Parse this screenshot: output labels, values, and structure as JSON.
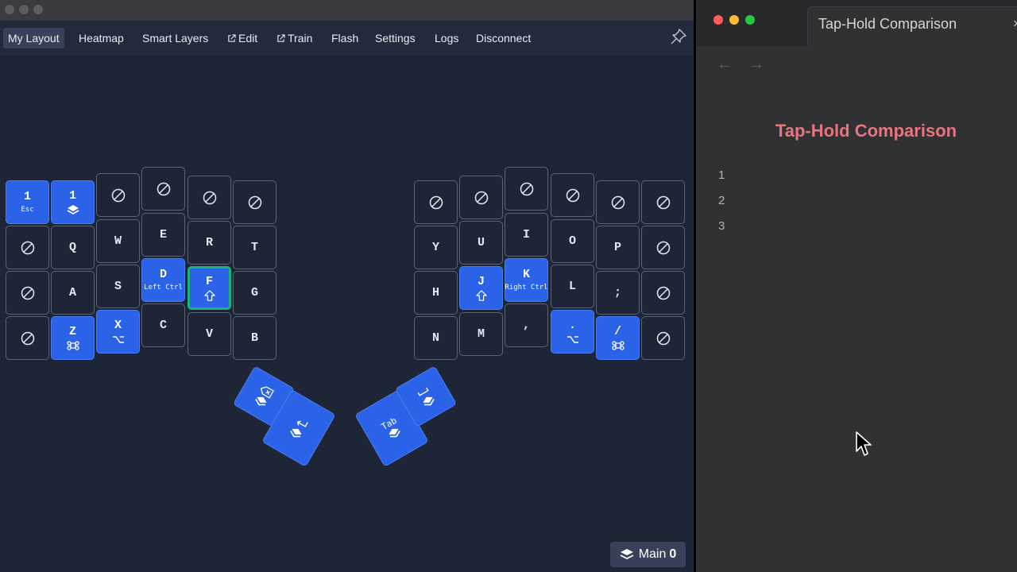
{
  "nav": {
    "my_layout": "My Layout",
    "heatmap": "Heatmap",
    "smart_layers": "Smart Layers",
    "edit": "Edit",
    "train": "Train",
    "flash": "Flash",
    "settings": "Settings",
    "logs": "Logs",
    "disconnect": "Disconnect"
  },
  "keys": {
    "l_num1_esc": {
      "main": "1",
      "sub": "Esc"
    },
    "l_num1_layer": {
      "main": "1"
    },
    "q": {
      "main": "Q"
    },
    "w": {
      "main": "W"
    },
    "e": {
      "main": "E"
    },
    "r": {
      "main": "R"
    },
    "t": {
      "main": "T"
    },
    "a": {
      "main": "A"
    },
    "s": {
      "main": "S"
    },
    "d": {
      "main": "D",
      "sub": "Left Ctrl"
    },
    "f": {
      "main": "F"
    },
    "g": {
      "main": "G"
    },
    "z": {
      "main": "Z"
    },
    "x": {
      "main": "X"
    },
    "c": {
      "main": "C"
    },
    "v": {
      "main": "V"
    },
    "b": {
      "main": "B"
    },
    "y": {
      "main": "Y"
    },
    "u": {
      "main": "U"
    },
    "i": {
      "main": "I"
    },
    "o": {
      "main": "O"
    },
    "p": {
      "main": "P"
    },
    "h": {
      "main": "H"
    },
    "j": {
      "main": "J"
    },
    "k": {
      "main": "K",
      "sub": "Right Ctrl"
    },
    "l": {
      "main": "L"
    },
    "semicolon": {
      "main": ";"
    },
    "n": {
      "main": "N"
    },
    "m": {
      "main": "M"
    },
    "comma": {
      "main": ","
    },
    "period": {
      "main": "."
    },
    "slash": {
      "main": "/"
    },
    "thumb_tab": {
      "main": "Tab"
    }
  },
  "layer_badge": {
    "label": "Main",
    "number": "0"
  },
  "right_window": {
    "tab_title": "Tap-Hold Comparison",
    "tab_close": "×",
    "doc_title": "Tap-Hold Comparison",
    "line_numbers": [
      "1",
      "2",
      "3"
    ]
  },
  "colors": {
    "key_blue": "#2a63e8",
    "highlight_green": "#1ab37a",
    "doc_title": "#e8757d",
    "close_light": "#ff5f57",
    "minimize_light": "#febc2e",
    "zoom_light": "#28c840"
  }
}
